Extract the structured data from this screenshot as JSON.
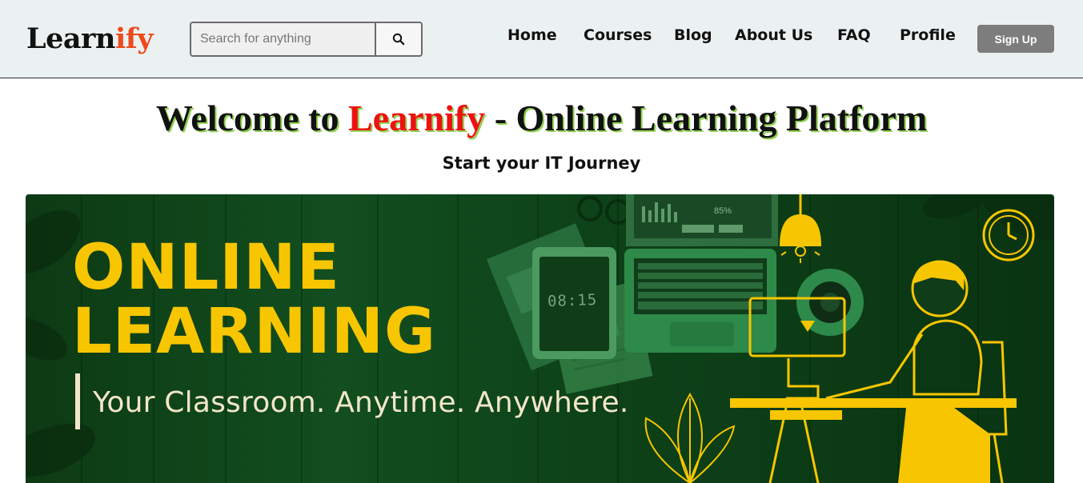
{
  "header": {
    "logo_main": "Learn",
    "logo_accent": "ify",
    "search_placeholder": "Search for anything",
    "search_button_icon": "search-icon",
    "nav": [
      {
        "label": "Home"
      },
      {
        "label": "Courses"
      },
      {
        "label": "Blog"
      },
      {
        "label": "About Us"
      },
      {
        "label": "FAQ"
      },
      {
        "label": "Profile"
      }
    ],
    "signup_label": "Sign Up"
  },
  "hero": {
    "welcome_prefix": "Welcome to ",
    "welcome_brand": "Learnify",
    "welcome_suffix": " - Online Learning Platform",
    "subtitle": "Start your IT Journey"
  },
  "banner": {
    "title_line1": "ONLINE",
    "title_line2": "LEARNING",
    "tagline": "Your Classroom. Anytime. Anywhere.",
    "tablet_time": "08:15",
    "laptop_percent": "85%"
  },
  "colors": {
    "header_bg": "#ebf1f1",
    "logo_accent": "#ee4a1c",
    "brand_red": "#ee1111",
    "banner_green": "#0e4219",
    "banner_yellow": "#f7c600",
    "signup_bg": "#7d7d7d"
  }
}
